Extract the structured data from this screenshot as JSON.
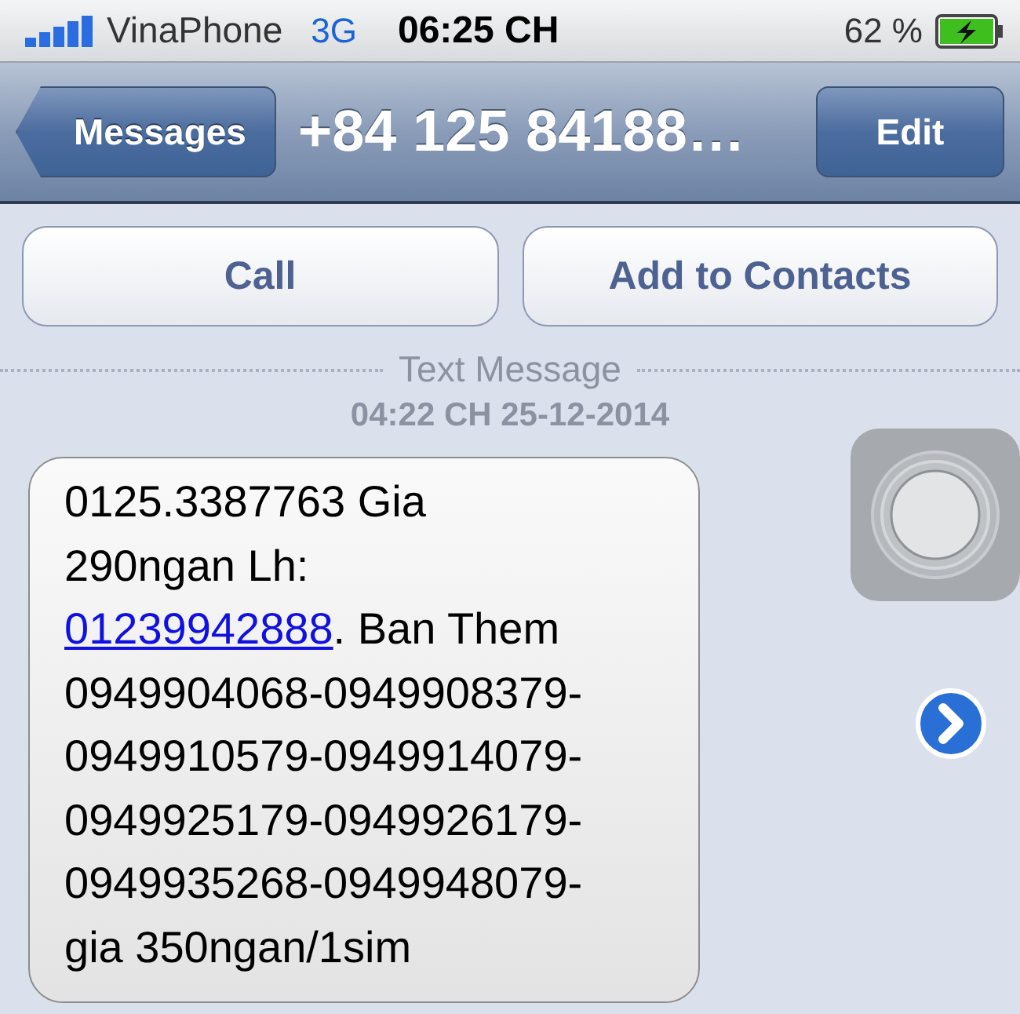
{
  "status_bar": {
    "carrier": "VinaPhone",
    "network": "3G",
    "time": "06:25 CH",
    "battery": "62 %"
  },
  "nav_bar": {
    "back": "Messages",
    "title": "+84 125 84188…",
    "action": "Edit"
  },
  "actions": [
    "Call",
    "Add to Contacts"
  ],
  "thread": {
    "label": "Text Message",
    "timestamp": "04:22 CH 25-12-2014"
  },
  "message": {
    "lines": [
      [
        {
          "kind": "text",
          "text": "0125.3387763 Gia"
        }
      ],
      [
        {
          "kind": "text",
          "text": "290ngan Lh:"
        }
      ],
      [
        {
          "kind": "link",
          "text": "01239942888"
        },
        {
          "kind": "text",
          "text": ". Ban Them"
        }
      ],
      [
        {
          "kind": "text",
          "text": "0949904068-0949908379-"
        }
      ],
      [
        {
          "kind": "text",
          "text": "0949910579-0949914079-"
        }
      ],
      [
        {
          "kind": "text",
          "text": "0949925179-0949926179-"
        }
      ],
      [
        {
          "kind": "text",
          "text": "0949935268-0949948079-"
        }
      ],
      [
        {
          "kind": "text",
          "text": "gia 350ngan/1sim"
        }
      ]
    ]
  }
}
